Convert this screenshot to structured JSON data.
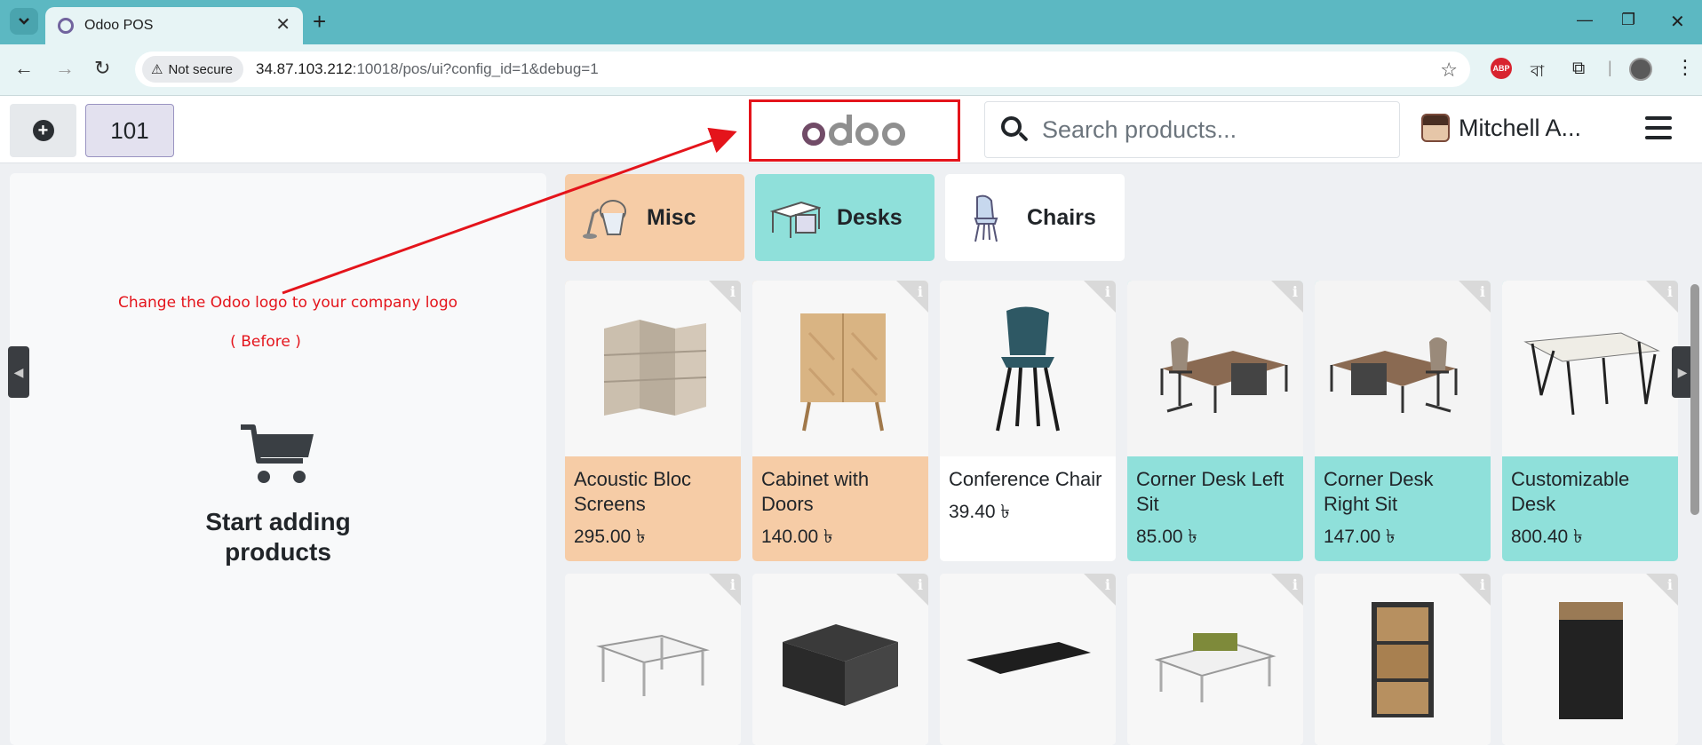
{
  "browser": {
    "tab_title": "Odoo POS",
    "not_secure_label": "Not secure",
    "url_host": "34.87.103.212",
    "url_rest": ":10018/pos/ui?config_id=1&debug=1",
    "ext_bangla": "বা"
  },
  "header": {
    "order_number": "101",
    "logo_text": "odoo",
    "search_placeholder": "Search products...",
    "user_name": "Mitchell A..."
  },
  "annotation": {
    "line1": "Change the Odoo logo to your company logo",
    "line2": "( Before )",
    "color": "#e4141b"
  },
  "left_panel": {
    "empty_label_line1": "Start adding",
    "empty_label_line2": "products"
  },
  "categories": [
    {
      "label": "Misc",
      "color": "#f6cca6"
    },
    {
      "label": "Desks",
      "color": "#8fe0da"
    },
    {
      "label": "Chairs",
      "color": "#ffffff"
    }
  ],
  "products": [
    {
      "name": "Acoustic Bloc Screens",
      "price": "295.00 ৳"
    },
    {
      "name": "Cabinet with Doors",
      "price": "140.00 ৳"
    },
    {
      "name": "Conference Chair",
      "price": "39.40 ৳"
    },
    {
      "name": "Corner Desk Left Sit",
      "price": "85.00 ৳"
    },
    {
      "name": "Corner Desk Right Sit",
      "price": "147.00 ৳"
    },
    {
      "name": "Customizable Desk",
      "price": "800.40 ৳"
    }
  ]
}
